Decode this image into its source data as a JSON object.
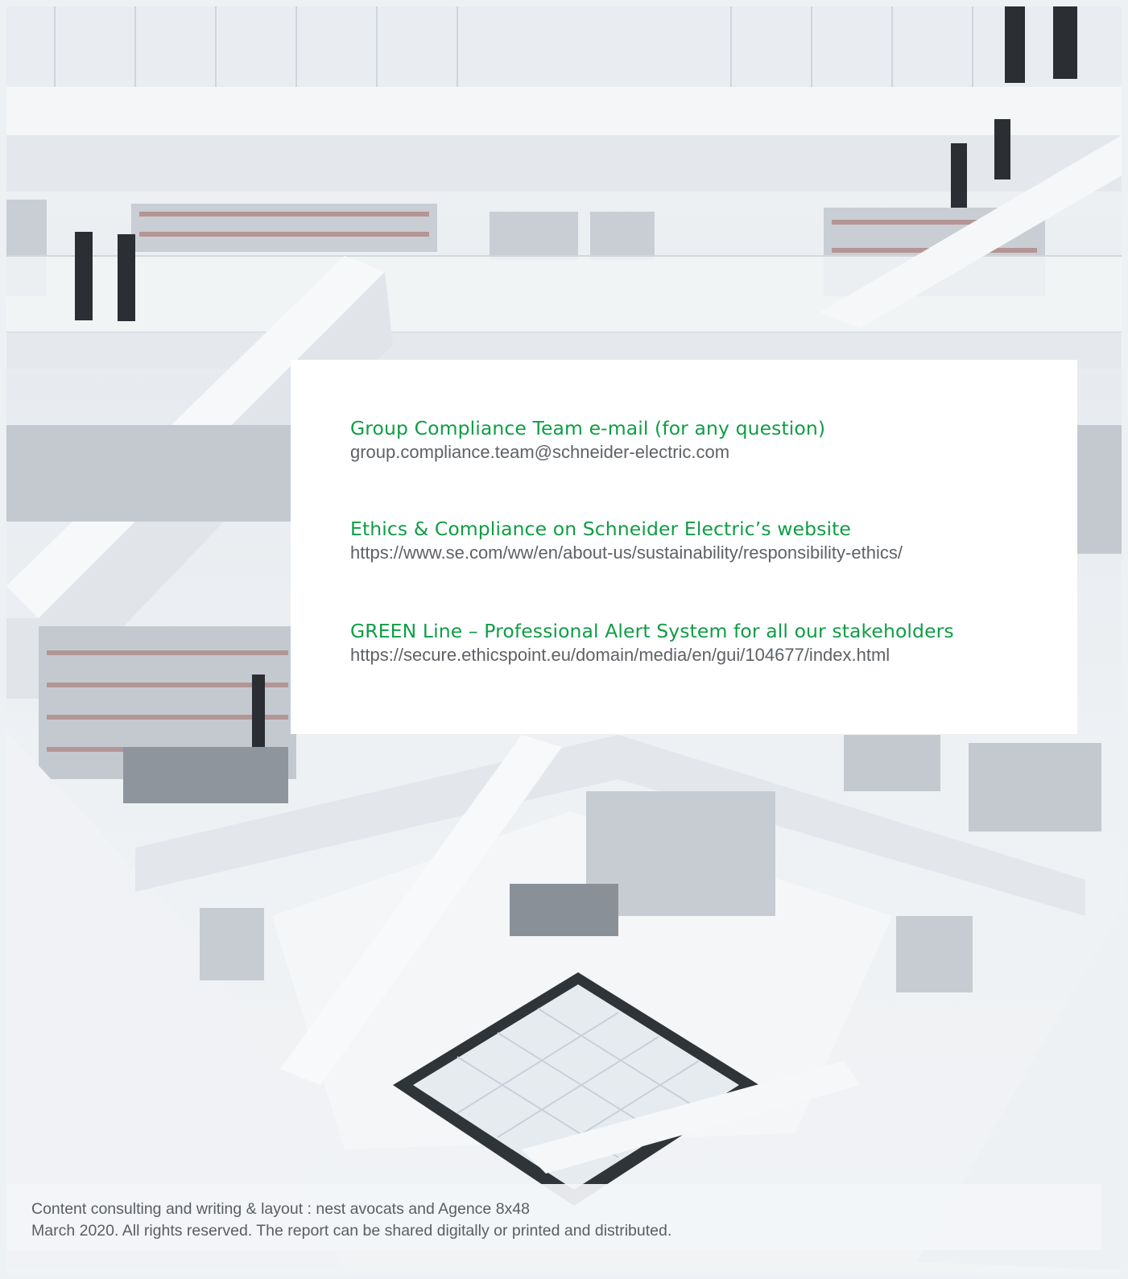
{
  "contacts": [
    {
      "heading": "Group Compliance Team e-mail (for any question)",
      "detail": "group.compliance.team@schneider-electric.com"
    },
    {
      "heading": "Ethics & Compliance on Schneider Electric’s website",
      "detail": "https://www.se.com/ww/en/about-us/sustainability/responsibility-ethics/"
    },
    {
      "heading": "GREEN Line – Professional Alert System for all our stakeholders",
      "detail": "https://secure.ethicspoint.eu/domain/media/en/gui/104677/index.html"
    }
  ],
  "footer": {
    "credits": "Content consulting and writing & layout : nest avocats and Agence 8x48",
    "rights": "March 2020. All rights reserved. The report can be shared digitally or printed and distributed."
  },
  "colors": {
    "heading_green": "#0f9d45",
    "detail_grey": "#5e6266"
  }
}
